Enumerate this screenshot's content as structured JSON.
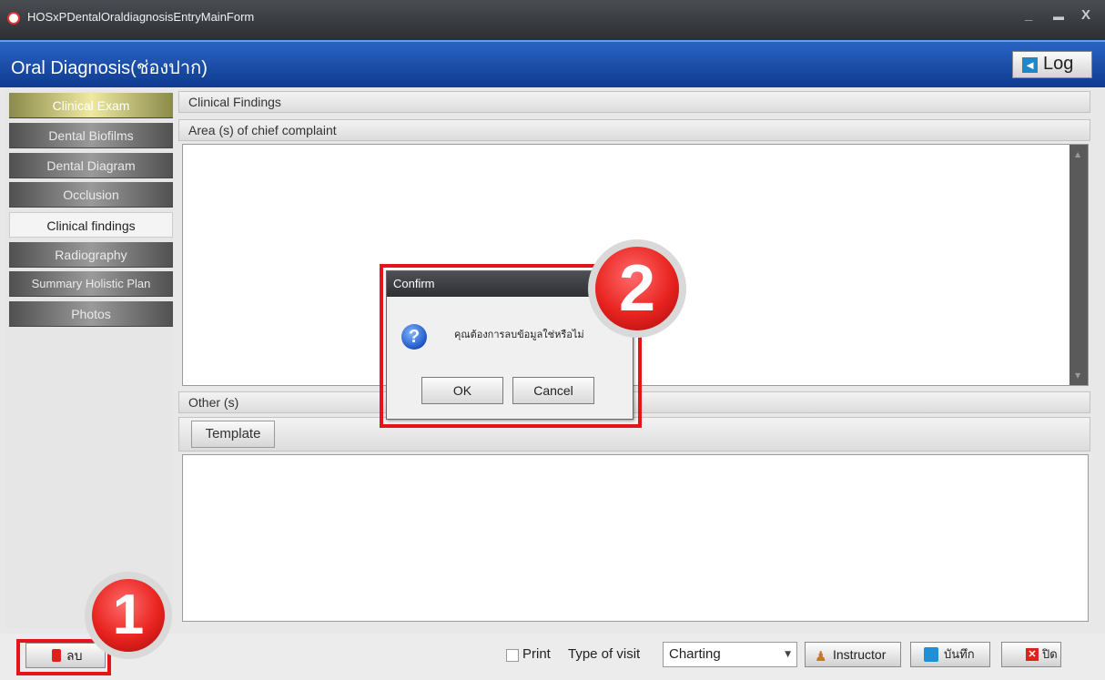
{
  "window": {
    "title": "HOSxPDentalOraldiagnosisEntryMainForm",
    "minimize": "_",
    "maximize": "▬",
    "close": "X"
  },
  "header": {
    "title": "Oral Diagnosis(ช่องปาก)",
    "log_label": "Log"
  },
  "sidebar": {
    "items": [
      {
        "label": "Clinical Exam"
      },
      {
        "label": "Dental Biofilms"
      },
      {
        "label": "Dental Diagram"
      },
      {
        "label": "Occlusion"
      },
      {
        "label": "Clinical findings"
      },
      {
        "label": "Radiography"
      },
      {
        "label": "Summary Holistic Plan"
      },
      {
        "label": "Photos"
      }
    ]
  },
  "main": {
    "section_title": "Clinical Findings",
    "chief_complaint_label": "Area (s) of chief complaint",
    "other_label": "Other (s)",
    "template_label": "Template"
  },
  "dialog": {
    "title": "Confirm",
    "message": "คุณต้องการลบข้อมูลใช่หรือไม่",
    "ok_label": "OK",
    "cancel_label": "Cancel"
  },
  "bottom": {
    "delete_label": "ลบ",
    "print_label": "Print",
    "type_of_visit_label": "Type of visit",
    "type_of_visit_value": "Charting",
    "instructor_label": "Instructor",
    "save_label": "บันทึก",
    "close_label": "ปิด"
  },
  "annotations": {
    "step1": "1",
    "step2": "2"
  },
  "colors": {
    "header_blue": "#1a4fb0",
    "highlight_red": "#e3141a",
    "selected_nav": "#efe9a0"
  }
}
